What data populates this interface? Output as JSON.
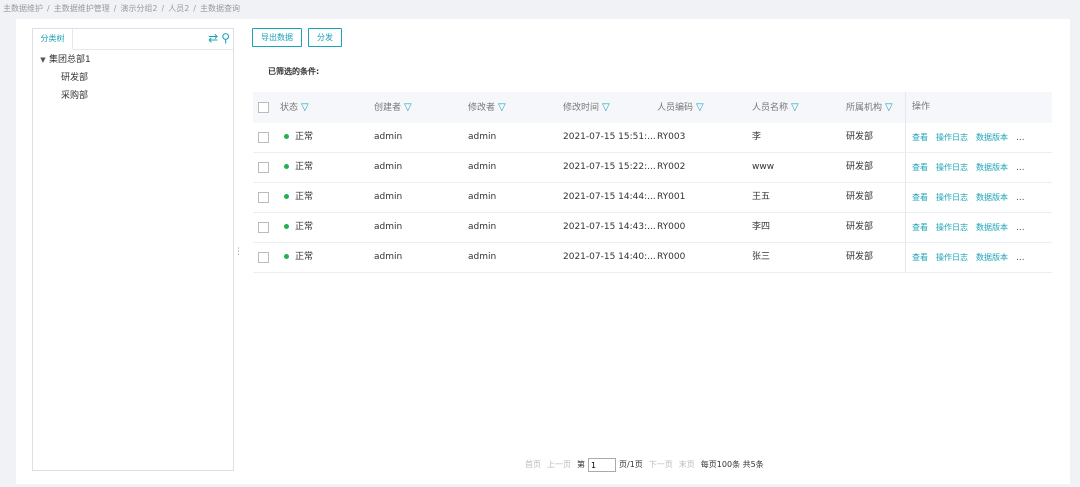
{
  "breadcrumb": [
    "主数据维护",
    "主数据维护管理",
    "演示分组2",
    "人员2",
    "主数据查询"
  ],
  "tree": {
    "tab_label": "分类树",
    "nodes": [
      {
        "label": "集团总部1",
        "level": 0,
        "expanded": true
      },
      {
        "label": "研发部",
        "level": 1
      },
      {
        "label": "采购部",
        "level": 1
      }
    ]
  },
  "toolbar": {
    "export_label": "导出数据",
    "distribute_label": "分发"
  },
  "filters": {
    "label": "已筛选的条件:"
  },
  "table": {
    "columns": [
      "状态",
      "创建者",
      "修改者",
      "修改时间",
      "人员编码",
      "人员名称",
      "所属机构",
      "操作"
    ],
    "rows": [
      {
        "status": "正常",
        "creator": "admin",
        "modifier": "admin",
        "time": "2021-07-15 15:51:...",
        "code": "RY003",
        "name": "李",
        "org": "研发部"
      },
      {
        "status": "正常",
        "creator": "admin",
        "modifier": "admin",
        "time": "2021-07-15 15:22:...",
        "code": "RY002",
        "name": "www",
        "org": "研发部"
      },
      {
        "status": "正常",
        "creator": "admin",
        "modifier": "admin",
        "time": "2021-07-15 14:44:...",
        "code": "RY001",
        "name": "王五",
        "org": "研发部"
      },
      {
        "status": "正常",
        "creator": "admin",
        "modifier": "admin",
        "time": "2021-07-15 14:43:...",
        "code": "RY000",
        "name": "李四",
        "org": "研发部"
      },
      {
        "status": "正常",
        "creator": "admin",
        "modifier": "admin",
        "time": "2021-07-15 14:40:...",
        "code": "RY000",
        "name": "张三",
        "org": "研发部"
      }
    ],
    "row_actions": {
      "view": "查看",
      "log": "操作日志",
      "version": "数据版本",
      "more": "..."
    }
  },
  "pagination": {
    "first": "首页",
    "prev": "上一页",
    "page_prefix": "第",
    "page_value": "1",
    "page_suffix": "页/1页",
    "next": "下一页",
    "last": "末页",
    "summary": "每页100条 共5条"
  },
  "colors": {
    "accent": "#1aa3b8",
    "status_ok": "#22b14c"
  }
}
